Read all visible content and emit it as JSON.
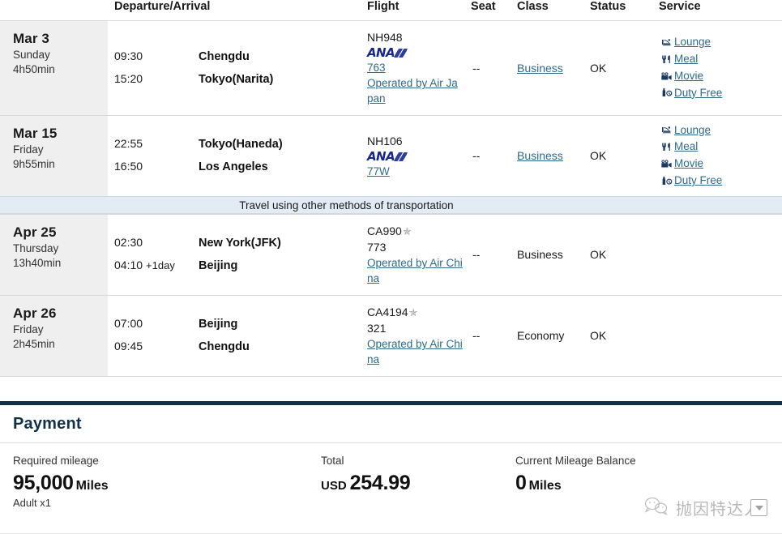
{
  "table": {
    "headers": {
      "departure_arrival": "Departure/Arrival",
      "flight": "Flight",
      "seat": "Seat",
      "class": "Class",
      "status": "Status",
      "service": "Service"
    },
    "banner_text": "Travel using other methods of transportation",
    "legs": [
      {
        "date": "Mar 3",
        "weekday": "Sunday",
        "duration": "4h50min",
        "depart_time": "09:30",
        "depart_city": "Chengdu",
        "arrive_time": "15:20",
        "arrive_day_offset": "",
        "arrive_city": "Tokyo(Narita)",
        "flight_number": "NH948",
        "carrier_logo": "ana-logo",
        "alliance_icon": "",
        "equipment": "763",
        "equipment_is_link": true,
        "operated_by": "Operated by Air Japan",
        "seat": "--",
        "class": "Business",
        "class_is_link": true,
        "status": "OK",
        "services": [
          {
            "icon": "lounge-icon",
            "label": "Lounge"
          },
          {
            "icon": "meal-icon",
            "label": "Meal"
          },
          {
            "icon": "movie-icon",
            "label": "Movie"
          },
          {
            "icon": "duty-free-icon",
            "label": "Duty Free"
          }
        ]
      },
      {
        "date": "Mar 15",
        "weekday": "Friday",
        "duration": "9h55min",
        "depart_time": "22:55",
        "depart_city": "Tokyo(Haneda)",
        "arrive_time": "16:50",
        "arrive_day_offset": "",
        "arrive_city": "Los Angeles",
        "flight_number": "NH106",
        "carrier_logo": "ana-logo",
        "alliance_icon": "",
        "equipment": "77W",
        "equipment_is_link": true,
        "operated_by": "",
        "seat": "--",
        "class": "Business",
        "class_is_link": true,
        "status": "OK",
        "services": [
          {
            "icon": "lounge-icon",
            "label": "Lounge"
          },
          {
            "icon": "meal-icon",
            "label": "Meal"
          },
          {
            "icon": "movie-icon",
            "label": "Movie"
          },
          {
            "icon": "duty-free-icon",
            "label": "Duty Free"
          }
        ]
      },
      {
        "date": "Apr 25",
        "weekday": "Thursday",
        "duration": "13h40min",
        "depart_time": "02:30",
        "depart_city": "New York(JFK)",
        "arrive_time": "04:10",
        "arrive_day_offset": "+1day",
        "arrive_city": "Beijing",
        "flight_number": "CA990",
        "carrier_logo": "",
        "alliance_icon": "star-alliance-icon",
        "equipment": "773",
        "equipment_is_link": false,
        "operated_by": "Operated by Air China",
        "seat": "--",
        "class": "Business",
        "class_is_link": false,
        "status": "OK",
        "services": []
      },
      {
        "date": "Apr 26",
        "weekday": "Friday",
        "duration": "2h45min",
        "depart_time": "07:00",
        "depart_city": "Beijing",
        "arrive_time": "09:45",
        "arrive_day_offset": "",
        "arrive_city": "Chengdu",
        "flight_number": "CA4194",
        "carrier_logo": "",
        "alliance_icon": "star-alliance-icon",
        "equipment": "321",
        "equipment_is_link": false,
        "operated_by": "Operated by Air China",
        "seat": "--",
        "class": "Economy",
        "class_is_link": false,
        "status": "OK",
        "services": []
      }
    ]
  },
  "payment": {
    "title": "Payment",
    "required_mileage_label": "Required mileage",
    "required_mileage_value": "95,000",
    "required_mileage_unit": "Miles",
    "passenger_note": "Adult x1",
    "total_label": "Total",
    "total_currency": "USD",
    "total_value": "254.99",
    "balance_label": "Current Mileage Balance",
    "balance_value": "0",
    "balance_unit": "Miles"
  },
  "watermark": {
    "text": "抛因特达人"
  },
  "colors": {
    "link": "#2e6b8a",
    "payment_heading": "#123047",
    "date_column_bg": "#efefef",
    "banner_bg": "#e3ecf5",
    "ana_blue": "#17288c"
  }
}
